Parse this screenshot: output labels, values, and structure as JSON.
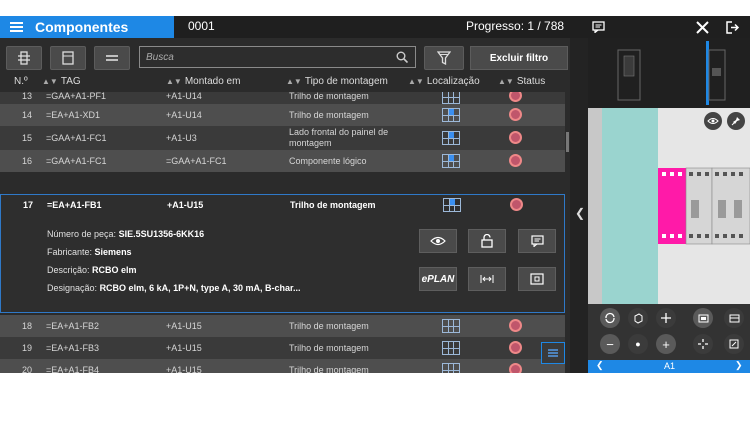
{
  "header": {
    "app_title": "Componentes",
    "code": "0001",
    "progress": "Progresso: 1 / 788"
  },
  "toolbar": {
    "search_placeholder": "Busca",
    "clear_filter": "Excluir filtro"
  },
  "columns": [
    "N.º",
    "TAG",
    "Montado em",
    "Tipo de montagem",
    "Localização",
    "Status"
  ],
  "rows_before": [
    {
      "n": "13",
      "tag": "=GAA+A1-PF1",
      "mounted": "+A1-U14",
      "type": "Trilho de montagem"
    },
    {
      "n": "14",
      "tag": "=EA+A1-XD1",
      "mounted": "+A1-U14",
      "type": "Trilho de montagem"
    },
    {
      "n": "15",
      "tag": "=GAA+A1-FC1",
      "mounted": "+A1-U3",
      "type": "Lado frontal do painel de montagem"
    },
    {
      "n": "16",
      "tag": "=GAA+A1-FC1",
      "mounted": "=GAA+A1-FC1",
      "type": "Componente lógico"
    }
  ],
  "expanded": {
    "n": "17",
    "tag": "=EA+A1-FB1",
    "mounted": "+A1-U15",
    "type": "Trilho de montagem",
    "part_label": "Número de peça:",
    "part_value": "SIE.5SU1356-6KK16",
    "maker_label": "Fabricante:",
    "maker_value": "Siemens",
    "desc_label": "Descrição:",
    "desc_value": "RCBO elm",
    "designation_label": "Designação:",
    "designation_value": "RCBO elm, 6 kA, 1P+N, type A, 30 mA, B-char...",
    "eplan_label": "ePLAN"
  },
  "rows_after": [
    {
      "n": "18",
      "tag": "=EA+A1-FB2",
      "mounted": "+A1-U15",
      "type": "Trilho de montagem"
    },
    {
      "n": "19",
      "tag": "=EA+A1-FB3",
      "mounted": "+A1-U15",
      "type": "Trilho de montagem"
    },
    {
      "n": "20",
      "tag": "=EA+A1-FB4",
      "mounted": "+A1-U15",
      "type": "Trilho de montagem"
    }
  ],
  "viewer": {
    "nav_label": "A1"
  },
  "colors": {
    "accent": "#1e88e5",
    "magenta": "#ff1aa8",
    "status": "#c0566b",
    "teal": "#9ad4cf"
  }
}
